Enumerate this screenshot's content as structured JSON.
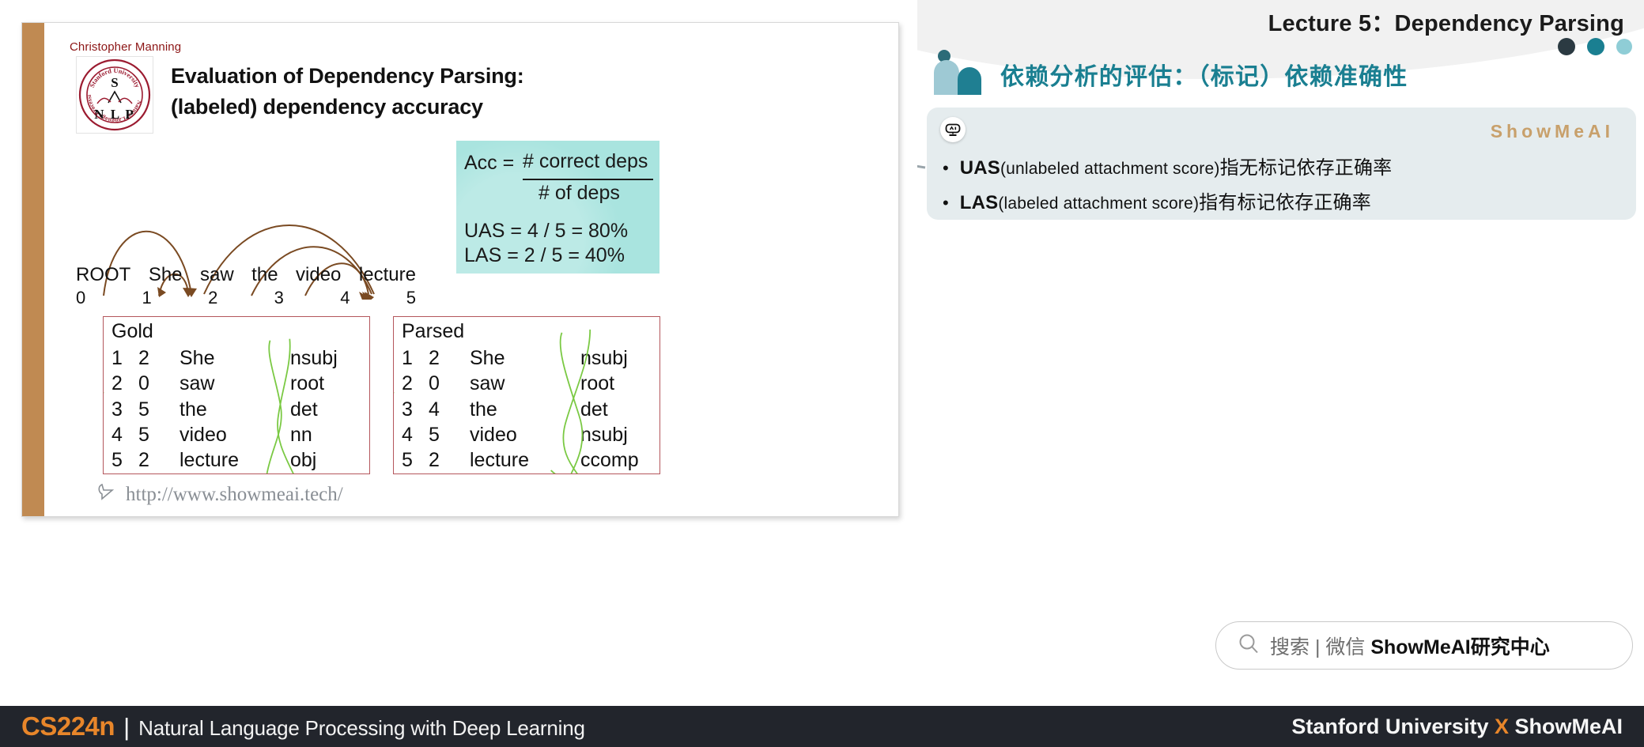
{
  "header": {
    "lecture_title": "Lecture 5：Dependency Parsing",
    "section_title": "依赖分析的评估：（标记）依赖准确性",
    "deco_dots": [
      "dot-dark",
      "dot-teal",
      "dot-light-teal"
    ],
    "accent_color": "#1a7f91"
  },
  "callout": {
    "bot_icon": "ai-robot-icon",
    "watermark": "ShowMeAI",
    "watermark_color": "#c8a06b",
    "bullets": [
      {
        "bullet": "•",
        "term": "UAS",
        "paren": "(unlabeled attachment score)",
        "rest": "指无标记依存正确率"
      },
      {
        "bullet": "•",
        "term": "LAS",
        "paren": "(labeled attachment score)",
        "rest": "指有标记依存正确率"
      }
    ]
  },
  "slide": {
    "author": "Christopher Manning",
    "logo": {
      "name": "stanford-nlp-logo",
      "ring_top": "Stanford University",
      "ring_bottom": "Natural Language Processing",
      "letter_top": "S",
      "letters_bottom": "N L P",
      "color": "#9b1b30"
    },
    "title_line1": "Evaluation of Dependency Parsing:",
    "title_line2": "(labeled) dependency accuracy",
    "dependency_diagram": {
      "words": [
        "ROOT",
        "She",
        "saw",
        "the",
        "video",
        "lecture"
      ],
      "indices": [
        "0",
        "1",
        "2",
        "3",
        "4",
        "5"
      ],
      "arc_color": "#7a4a22"
    },
    "formula": {
      "acc_label": "Acc  =",
      "numerator": "# correct deps",
      "denominator": "# of deps",
      "uas_line": "UAS =  4 / 5  =  80%",
      "las_line": "LAS  =  2 / 5  =  40%",
      "bg_color": "#a9e4df"
    },
    "gold_table": {
      "title": "Gold",
      "rows": [
        {
          "id": "1",
          "head": "2",
          "word": "She",
          "label": "nsubj"
        },
        {
          "id": "2",
          "head": "0",
          "word": "saw",
          "label": "root"
        },
        {
          "id": "3",
          "head": "5",
          "word": "the",
          "label": "det"
        },
        {
          "id": "4",
          "head": "5",
          "word": "video",
          "label": "nn"
        },
        {
          "id": "5",
          "head": "2",
          "word": "lecture",
          "label": "obj"
        }
      ]
    },
    "parsed_table": {
      "title": "Parsed",
      "rows": [
        {
          "id": "1",
          "head": "2",
          "word": "She",
          "label": "nsubj"
        },
        {
          "id": "2",
          "head": "0",
          "word": "saw",
          "label": "root"
        },
        {
          "id": "3",
          "head": "4",
          "word": "the",
          "label": "det"
        },
        {
          "id": "4",
          "head": "5",
          "word": "video",
          "label": "nsubj"
        },
        {
          "id": "5",
          "head": "2",
          "word": "lecture",
          "label": "ccomp"
        }
      ]
    },
    "site_url": "http://www.showmeai.tech/",
    "cursor_icon": "pointer-cursor-icon"
  },
  "search": {
    "icon": "search-icon",
    "prefix": "搜索 | 微信 ",
    "brand": "ShowMeAI研究中心"
  },
  "bottom_bar": {
    "course_code": "CS224n",
    "separator": "|",
    "course_name": "Natural Language Processing with Deep Learning",
    "right_text_prefix": "Stanford University ",
    "right_text_x": "X",
    "right_text_suffix": " ShowMeAI",
    "accent_color": "#e8862a",
    "bg_color": "#22252c"
  }
}
